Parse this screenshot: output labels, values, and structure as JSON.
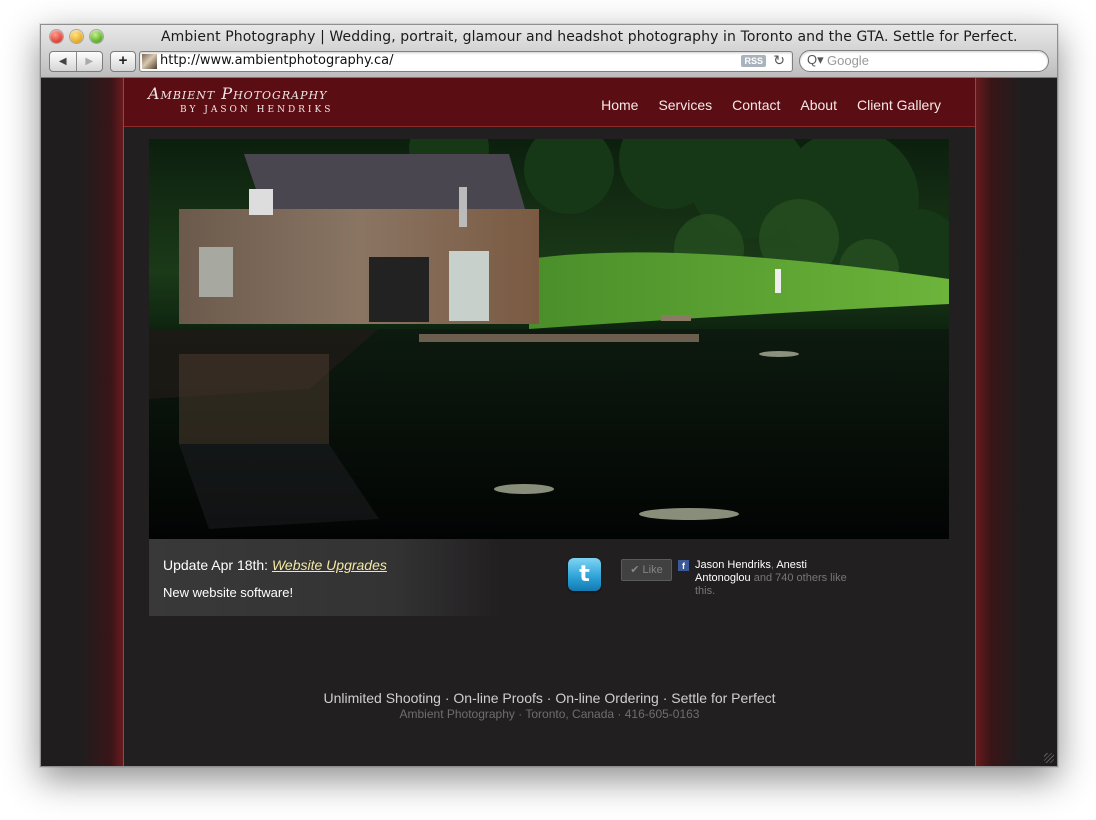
{
  "window": {
    "title": "Ambient Photography | Wedding, portrait, glamour and headshot photography in Toronto and the GTA. Settle for Perfect."
  },
  "toolbar": {
    "back_icon": "◀",
    "forward_icon": "▶",
    "add_label": "+",
    "url": "http://www.ambientphotography.ca/",
    "rss_label": "RSS",
    "reload_icon": "↻",
    "search_icon": "Q▾",
    "search_placeholder": "Google"
  },
  "site": {
    "logo_main": "Ambient Photography",
    "logo_sub": "by Jason Hendriks",
    "nav": [
      "Home",
      "Services",
      "Contact",
      "About",
      "Client Gallery"
    ]
  },
  "update": {
    "prefix": "Update Apr 18th: ",
    "link": "Website Upgrades",
    "body": "New website software!"
  },
  "social": {
    "twitter_glyph": "t",
    "like_label": "✔ Like",
    "fb_glyph": "f",
    "fb_name1": "Jason Hendriks",
    "fb_sep": ", ",
    "fb_name2": "Anesti Antonoglou",
    "fb_rest": " and 740 others like this."
  },
  "footer": {
    "tagline": "Unlimited Shooting · On-line Proofs · On-line Ordering · Settle for Perfect",
    "address": "Ambient Photography · Toronto, Canada · 416-605-0163"
  },
  "colors": {
    "header_bg": "#5a0d12",
    "page_bg": "#221f21",
    "link_accent": "#f3e7a3"
  }
}
